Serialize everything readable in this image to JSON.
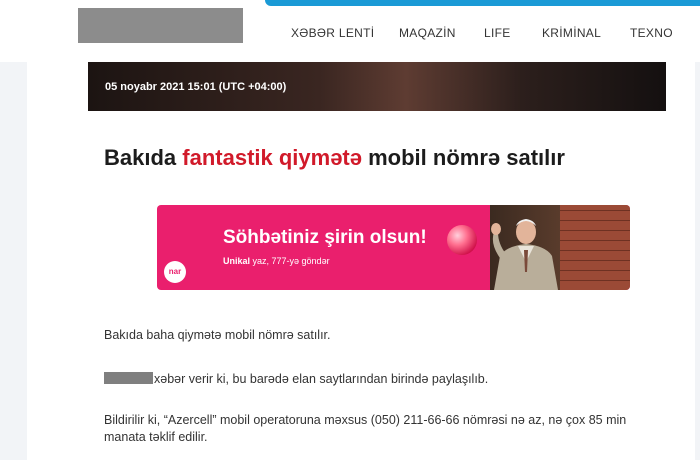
{
  "nav": {
    "items": [
      {
        "label": "XƏBƏR LENTİ"
      },
      {
        "label": "MAQAZİN"
      },
      {
        "label": "LIFE"
      },
      {
        "label": "KRİMİNAL"
      },
      {
        "label": "TEXNO"
      }
    ]
  },
  "article": {
    "dateline": "05 noyabr 2021 15:01 (UTC +04:00)",
    "headline": {
      "before": "Bakıda ",
      "highlight": "fantastik qiymətə",
      "after": " mobil nömrə satılır"
    },
    "paragraphs": [
      "Bakıda baha qiymətə mobil nömrə satılır.",
      "xəbər verir ki, bu barədə elan saytlarından birində paylaşılıb.",
      "Bildirilir ki, “Azercell” mobil operatoruna məxsus (050) 211-66-66 nömrəsi nə az, nə çox 85 min manata təklif edilir."
    ]
  },
  "banner": {
    "title": "Söhbətiniz şirin olsun!",
    "sub_bold": "Unikal",
    "sub_rest": " yaz, 777-yə göndər",
    "logo_text": "nar"
  },
  "colors": {
    "accent_blue": "#1a9ad6",
    "headline_red": "#d11a2a",
    "banner_pink": "#ea1f6d"
  }
}
